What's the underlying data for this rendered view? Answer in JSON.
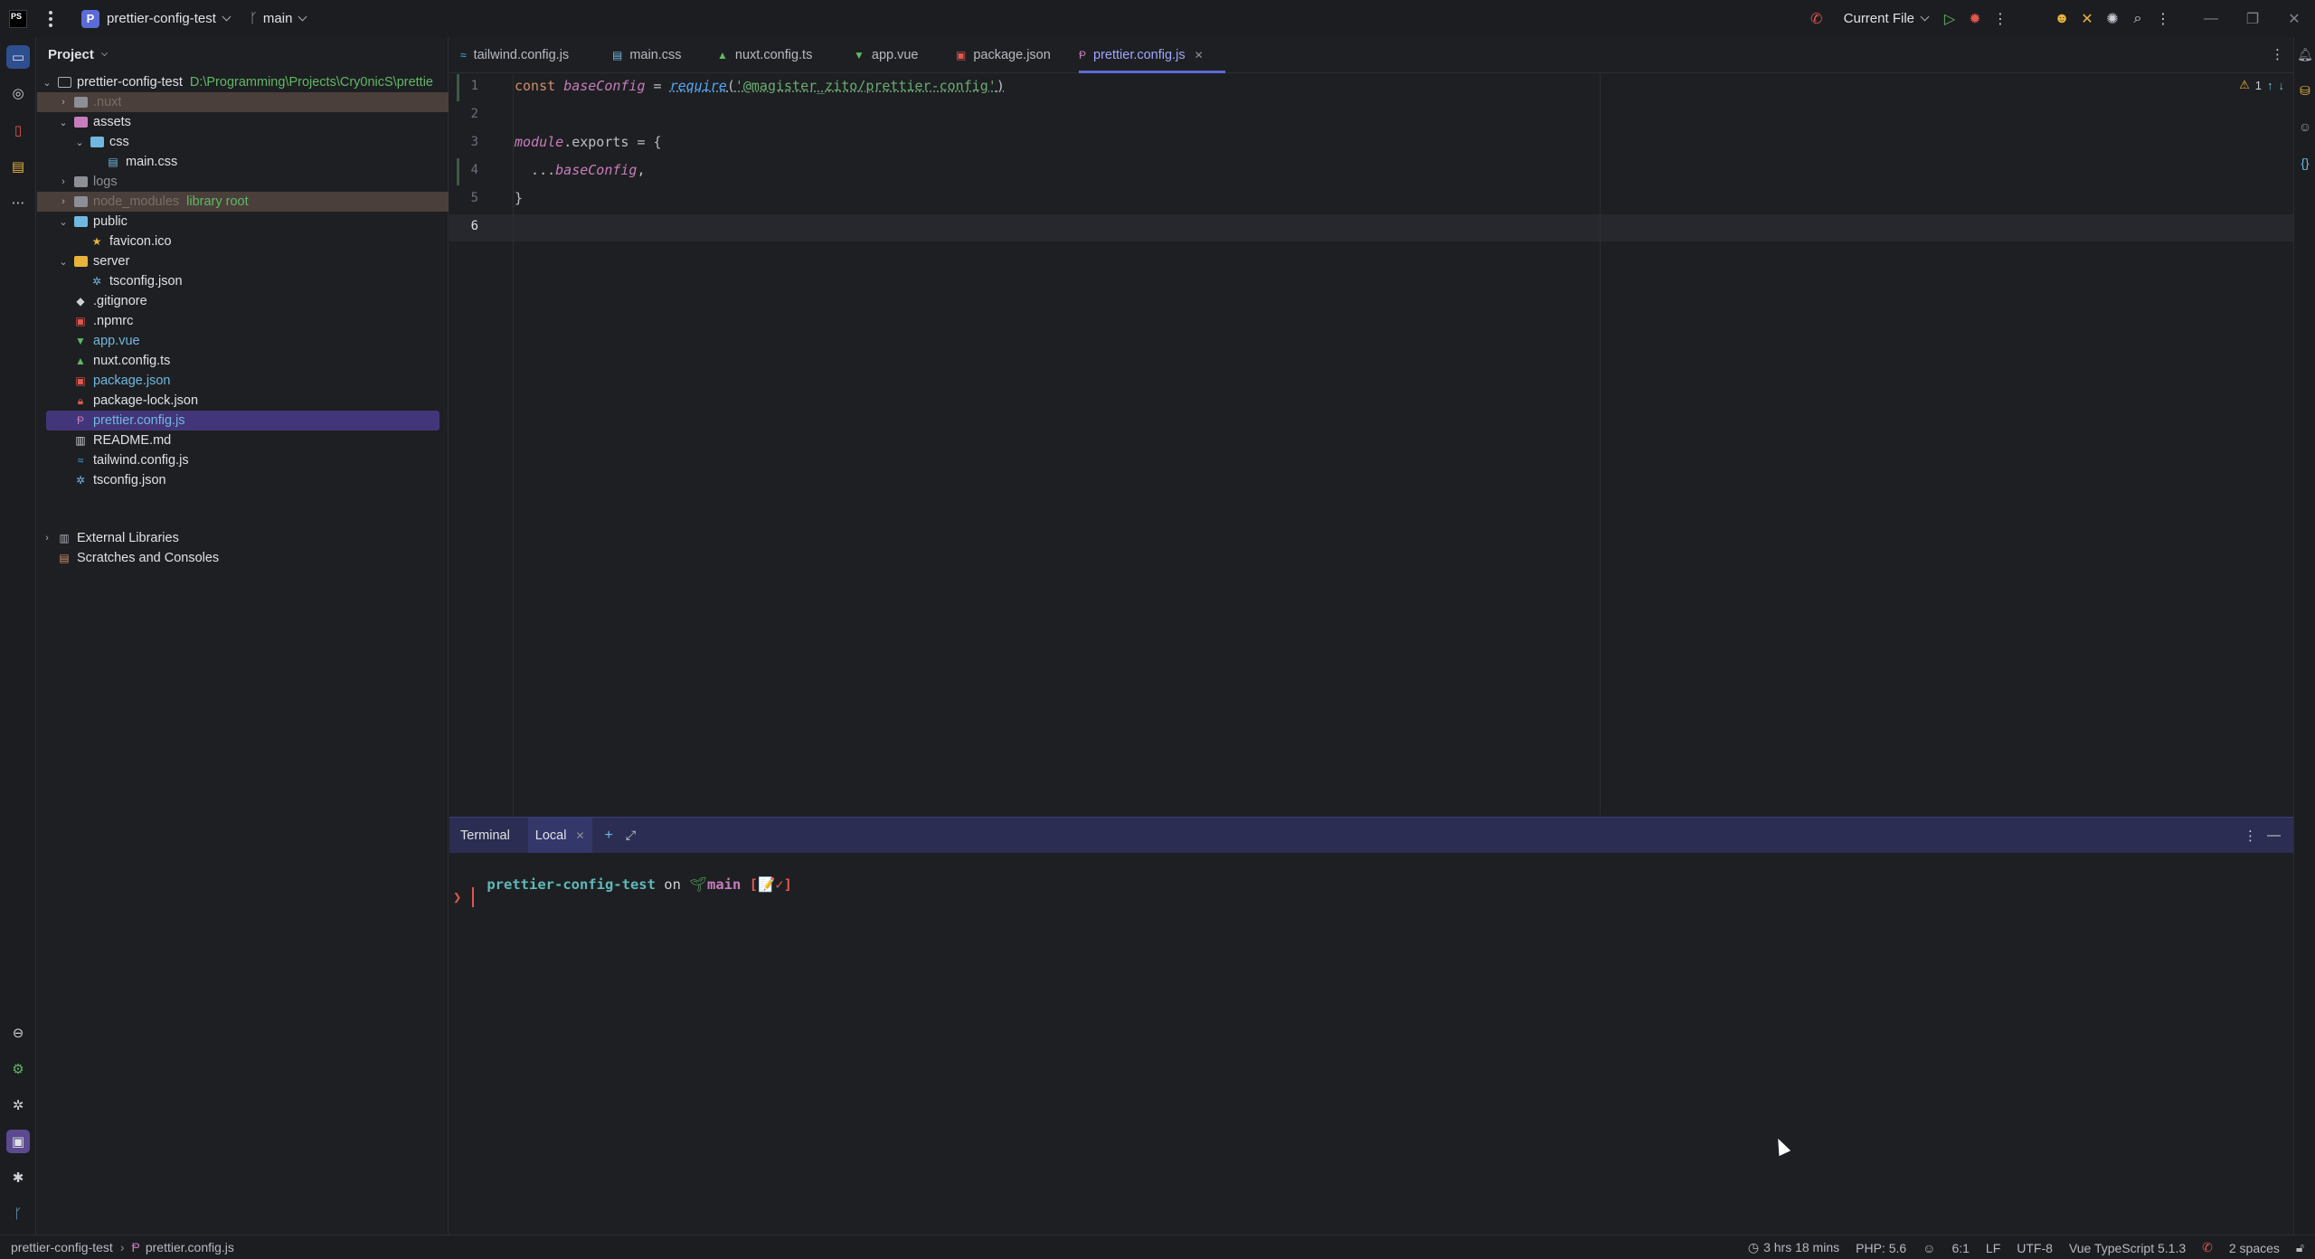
{
  "titlebar": {
    "app_badge": "PS",
    "project_initial": "P",
    "project_name": "prettier-config-test",
    "branch": "main",
    "run_config": "Current File"
  },
  "project_panel": {
    "title": "Project",
    "root_name": "prettier-config-test",
    "root_path": "D:\\Programming\\Projects\\Cry0nicS\\prettie",
    "items": [
      {
        "label": ".nuxt",
        "depth": 1,
        "type": "folder",
        "state": "collapsed",
        "color": "#7a6f66",
        "excluded": true
      },
      {
        "label": "assets",
        "depth": 1,
        "type": "folder",
        "state": "expanded",
        "color": "#dfe1e5"
      },
      {
        "label": "css",
        "depth": 2,
        "type": "folder",
        "state": "expanded",
        "color": "#dfe1e5"
      },
      {
        "label": "main.css",
        "depth": 3,
        "type": "file",
        "color": "#dfe1e5"
      },
      {
        "label": "logs",
        "depth": 1,
        "type": "folder",
        "state": "collapsed",
        "color": "#8c8f96"
      },
      {
        "label": "node_modules",
        "depth": 1,
        "type": "folder",
        "state": "collapsed",
        "color": "#7a6f66",
        "suffix": "library root",
        "excluded": true
      },
      {
        "label": "public",
        "depth": 1,
        "type": "folder",
        "state": "expanded",
        "color": "#dfe1e5"
      },
      {
        "label": "favicon.ico",
        "depth": 2,
        "type": "file",
        "color": "#dfe1e5"
      },
      {
        "label": "server",
        "depth": 1,
        "type": "folder",
        "state": "expanded",
        "color": "#dfe1e5"
      },
      {
        "label": "tsconfig.json",
        "depth": 2,
        "type": "file",
        "color": "#dfe1e5"
      },
      {
        "label": ".gitignore",
        "depth": 1,
        "type": "file",
        "color": "#dfe1e5"
      },
      {
        "label": ".npmrc",
        "depth": 1,
        "type": "file",
        "color": "#dfe1e5"
      },
      {
        "label": "app.vue",
        "depth": 1,
        "type": "file",
        "color": "#6fb8e0"
      },
      {
        "label": "nuxt.config.ts",
        "depth": 1,
        "type": "file",
        "color": "#dfe1e5"
      },
      {
        "label": "package.json",
        "depth": 1,
        "type": "file",
        "color": "#6fb8e0"
      },
      {
        "label": "package-lock.json",
        "depth": 1,
        "type": "file",
        "color": "#dfe1e5"
      },
      {
        "label": "prettier.config.js",
        "depth": 1,
        "type": "file",
        "color": "#6fb8e0",
        "selected": true
      },
      {
        "label": "README.md",
        "depth": 1,
        "type": "file",
        "color": "#dfe1e5"
      },
      {
        "label": "tailwind.config.js",
        "depth": 1,
        "type": "file",
        "color": "#dfe1e5"
      },
      {
        "label": "tsconfig.json",
        "depth": 1,
        "type": "file",
        "color": "#dfe1e5"
      }
    ],
    "external_libraries": "External Libraries",
    "scratches": "Scratches and Consoles"
  },
  "tabs": [
    {
      "label": "tailwind.config.js",
      "icon": "tailwind-icon"
    },
    {
      "label": "main.css",
      "icon": "css-icon"
    },
    {
      "label": "nuxt.config.ts",
      "icon": "nuxt-icon"
    },
    {
      "label": "app.vue",
      "icon": "vue-icon"
    },
    {
      "label": "package.json",
      "icon": "npm-icon"
    },
    {
      "label": "prettier.config.js",
      "icon": "prettier-icon",
      "active": true
    }
  ],
  "editor": {
    "line_numbers": [
      "1",
      "2",
      "3",
      "4",
      "5",
      "6"
    ],
    "line1": {
      "kw": "const ",
      "id": "baseConfig",
      "op": " = ",
      "fn": "require",
      "p1": "(",
      "str": "'@magister_zito/prettier-config'",
      "p2": ")"
    },
    "line3": {
      "kw": "module",
      "rest": ".exports = {"
    },
    "line4": {
      "spread": "  ...",
      "id": "baseConfig",
      "rest": ","
    },
    "line5": "}",
    "warnings": "1"
  },
  "terminal": {
    "title": "Terminal",
    "tab": "Local",
    "prompt_dir": "prettier-config-test",
    "prompt_on": " on ",
    "prompt_branch": "main",
    "prompt_status": "[📝✓]",
    "prompt_char": "❯"
  },
  "statusbar": {
    "breadcrumb_project": "prettier-config-test",
    "breadcrumb_file": "prettier.config.js",
    "time_tracker": "3 hrs 18 mins",
    "php": "PHP: 5.6",
    "position": "6:1",
    "line_ending": "LF",
    "encoding": "UTF-8",
    "language": "Vue TypeScript 5.1.3",
    "indent": "2 spaces"
  }
}
